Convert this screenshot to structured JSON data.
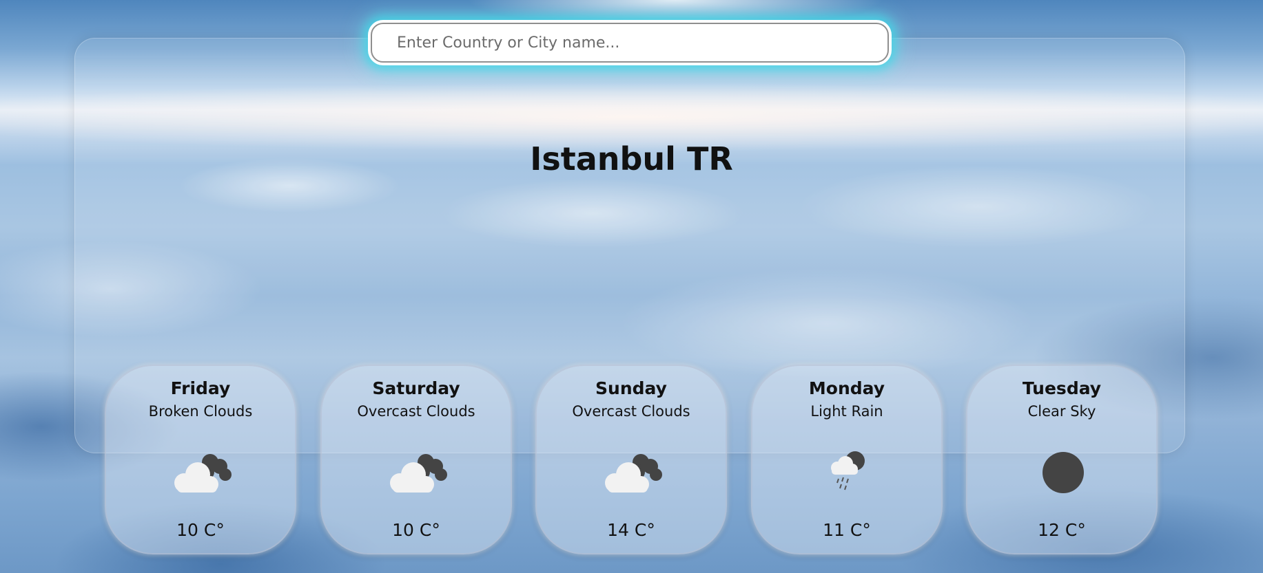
{
  "search": {
    "placeholder": "Enter Country or City name..."
  },
  "location": {
    "title": "Istanbul TR"
  },
  "forecast": [
    {
      "day": "Friday",
      "description": "Broken Clouds",
      "temp": "10 C°",
      "icon": "broken-clouds-icon"
    },
    {
      "day": "Saturday",
      "description": "Overcast Clouds",
      "temp": "10 C°",
      "icon": "overcast-clouds-icon"
    },
    {
      "day": "Sunday",
      "description": "Overcast Clouds",
      "temp": "14 C°",
      "icon": "overcast-clouds-icon"
    },
    {
      "day": "Monday",
      "description": "Light Rain",
      "temp": "11 C°",
      "icon": "light-rain-icon"
    },
    {
      "day": "Tuesday",
      "description": "Clear Sky",
      "temp": "12 C°",
      "icon": "clear-sky-icon"
    }
  ],
  "colors": {
    "search_glow": "#3cd7e6",
    "icon_dark": "#444444",
    "icon_light": "#f2f2f2",
    "text": "#111111"
  }
}
